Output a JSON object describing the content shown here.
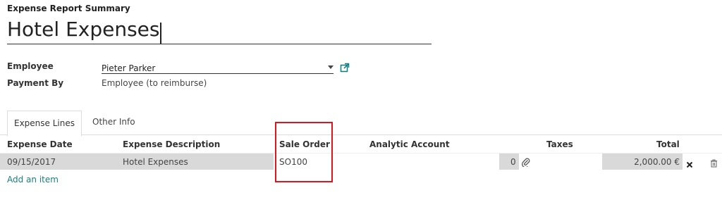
{
  "header": {
    "section_label": "Expense Report Summary",
    "title": "Hotel Expenses"
  },
  "form": {
    "employee_label": "Employee",
    "employee_value": "Pieter Parker",
    "payment_label": "Payment By",
    "payment_value": "Employee (to reimburse)"
  },
  "tabs": [
    {
      "label": "Expense Lines",
      "active": true
    },
    {
      "label": "Other Info",
      "active": false
    }
  ],
  "table": {
    "columns": [
      "Expense Date",
      "Expense Description",
      "Sale Order",
      "Analytic Account",
      "Taxes",
      "Total"
    ],
    "rows": [
      {
        "date": "09/15/2017",
        "description": "Hotel Expenses",
        "sale_order": "SO100",
        "analytic_account": "",
        "attachments": "0",
        "taxes": "",
        "total": "2,000.00 €"
      }
    ],
    "add_item_label": "Add an item"
  },
  "colors": {
    "accent": "#0a7e7e",
    "highlight_box": "#e0141e",
    "row_grey": "#d9d9d9"
  },
  "icons": {
    "dropdown": "caret-down-icon",
    "external": "external-link-icon",
    "attachment": "paperclip-icon",
    "remove": "close-icon",
    "delete": "trash-icon"
  }
}
